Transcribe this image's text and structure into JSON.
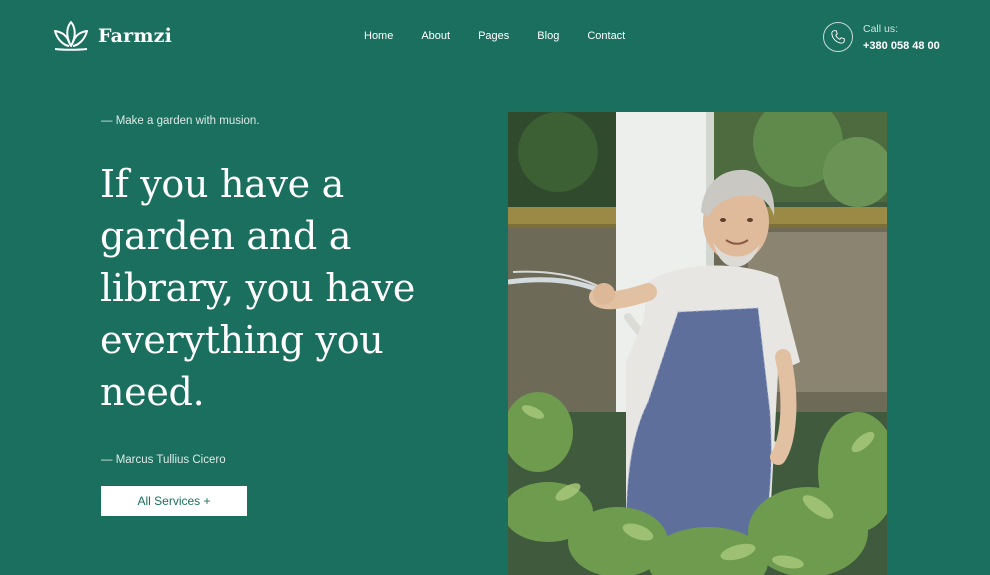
{
  "brand": {
    "name": "Farmzi"
  },
  "nav": {
    "items": [
      {
        "label": "Home"
      },
      {
        "label": "About"
      },
      {
        "label": "Pages"
      },
      {
        "label": "Blog"
      },
      {
        "label": "Contact"
      }
    ]
  },
  "contact": {
    "label": "Call us:",
    "phone": "+380 058 48 00",
    "icon": "phone-icon"
  },
  "hero": {
    "tagline": "— Make a garden with musion.",
    "headline": "If you have a garden and a library, you have everything you need.",
    "author": "— Marcus Tullius Cicero",
    "button_label": "All Services +"
  },
  "colors": {
    "background": "#1a6f5f",
    "text": "#ffffff",
    "button_bg": "#ffffff",
    "button_text": "#1a6f5f"
  }
}
